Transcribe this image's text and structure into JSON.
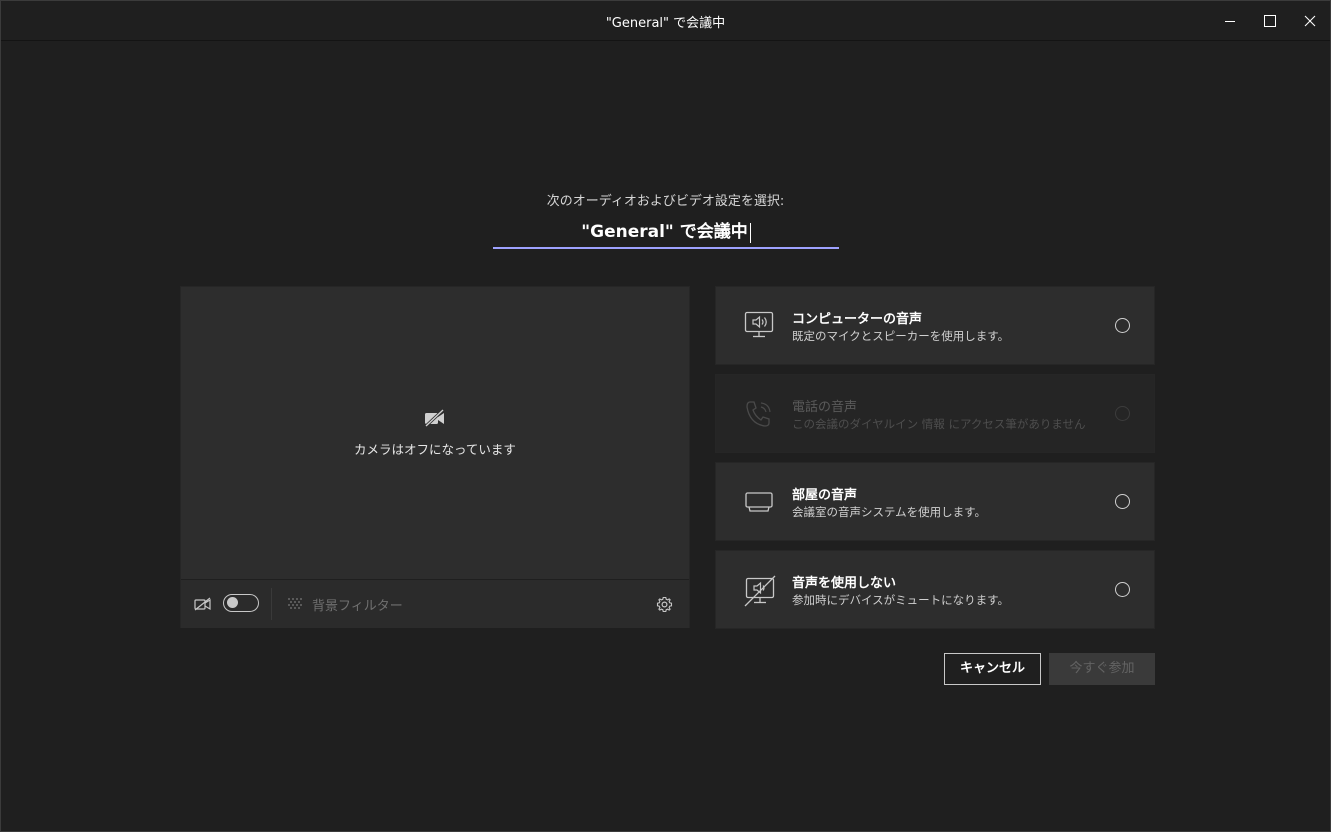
{
  "window": {
    "title": "\"General\" で会議中"
  },
  "window_controls": {
    "minimize_icon": "minimize-icon",
    "maximize_icon": "maximize-icon",
    "close_icon": "close-icon"
  },
  "setup": {
    "prompt": "次のオーディオおよびビデオ設定を選択:",
    "meeting_name": "\"General\" で会議中"
  },
  "video_preview": {
    "camera_off_text": "カメラはオフになっています",
    "background_filter_label": "背景フィルター",
    "camera_toggle_on": false
  },
  "audio_options": [
    {
      "title": "コンピューターの音声",
      "description": "既定のマイクとスピーカーを使用します。",
      "icon": "computer-audio-icon",
      "enabled": true,
      "selected": false
    },
    {
      "title": "電話の音声",
      "description": "この会議のダイヤルイン 情報 にアクセス筆がありません",
      "icon": "phone-audio-icon",
      "enabled": false,
      "selected": false
    },
    {
      "title": "部屋の音声",
      "description": "会議室の音声システムを使用します。",
      "icon": "room-audio-icon",
      "enabled": true,
      "selected": false
    },
    {
      "title": "音声を使用しない",
      "description": "参加時にデバイスがミュートになります。",
      "icon": "no-audio-icon",
      "enabled": true,
      "selected": false
    }
  ],
  "actions": {
    "cancel_label": "キャンセル",
    "join_label": "今すぐ参加"
  },
  "colors": {
    "background": "#1f1f1f",
    "panel": "#2d2d2d",
    "accent": "#9ea2ff"
  }
}
